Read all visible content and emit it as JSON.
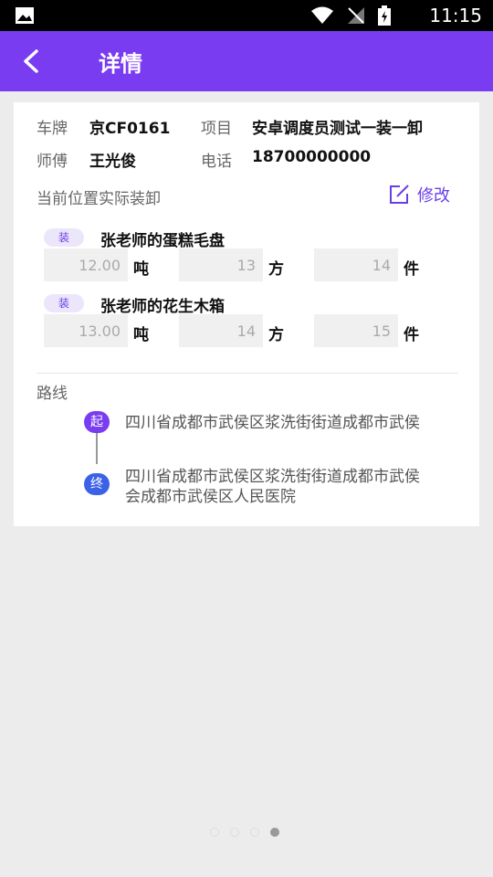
{
  "status_bar": {
    "time": "11:15"
  },
  "app_bar": {
    "title": "详情"
  },
  "info": {
    "plate_label": "车牌",
    "plate_value": "京CF0161",
    "project_label": "项目",
    "project_value": "安卓调度员测试一装一卸",
    "driver_label": "师傅",
    "driver_value": "王光俊",
    "phone_label": "电话",
    "phone_value": "18700000000"
  },
  "section": {
    "title": "当前位置实际装卸",
    "edit_label": "修改"
  },
  "goods": [
    {
      "tag": "装",
      "name": "张老师的蛋糕毛盘",
      "weight": "12.00",
      "weight_unit": "吨",
      "volume": "13",
      "volume_unit": "方",
      "count": "14",
      "count_unit": "件"
    },
    {
      "tag": "装",
      "name": "张老师的花生木箱",
      "weight": "13.00",
      "weight_unit": "吨",
      "volume": "14",
      "volume_unit": "方",
      "count": "15",
      "count_unit": "件"
    }
  ],
  "route": {
    "title": "路线",
    "start_badge": "起",
    "start_address": "四川省成都市武侯区浆洗街街道成都市武侯",
    "end_badge": "终",
    "end_address_line1": "四川省成都市武侯区浆洗街街道成都市武侯",
    "end_address_line2": "会成都市武侯区人民医院"
  },
  "pager": {
    "total": 4,
    "active": 4
  }
}
